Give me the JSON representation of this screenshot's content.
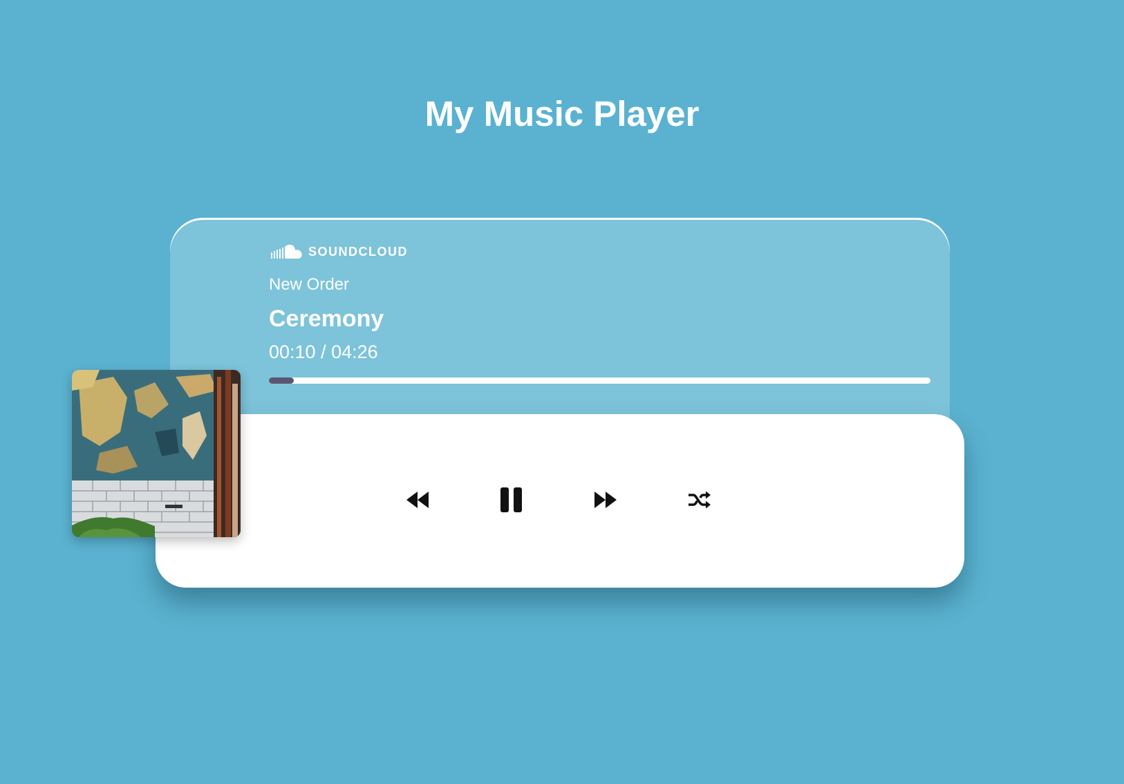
{
  "page": {
    "title": "My Music Player"
  },
  "player": {
    "brand": "SOUNDCLOUD",
    "artist": "New Order",
    "track": "Ceremony",
    "time_readout": "00:10 / 04:26",
    "elapsed": "00:10",
    "duration": "04:26",
    "progress": 0.0376,
    "album_art_icon": "album-art-image"
  },
  "controls": [
    {
      "name": "rewind",
      "icon": "rewind-icon"
    },
    {
      "name": "pause",
      "icon": "pause-icon"
    },
    {
      "name": "fast-forward",
      "icon": "fast-forward-icon"
    },
    {
      "name": "shuffle",
      "icon": "shuffle-icon"
    }
  ],
  "colors": {
    "background": "#5ab2d0",
    "panel": "#7dc3d9",
    "card": "#ffffff",
    "progress_fill": "#5b5670",
    "icon": "#111111"
  }
}
